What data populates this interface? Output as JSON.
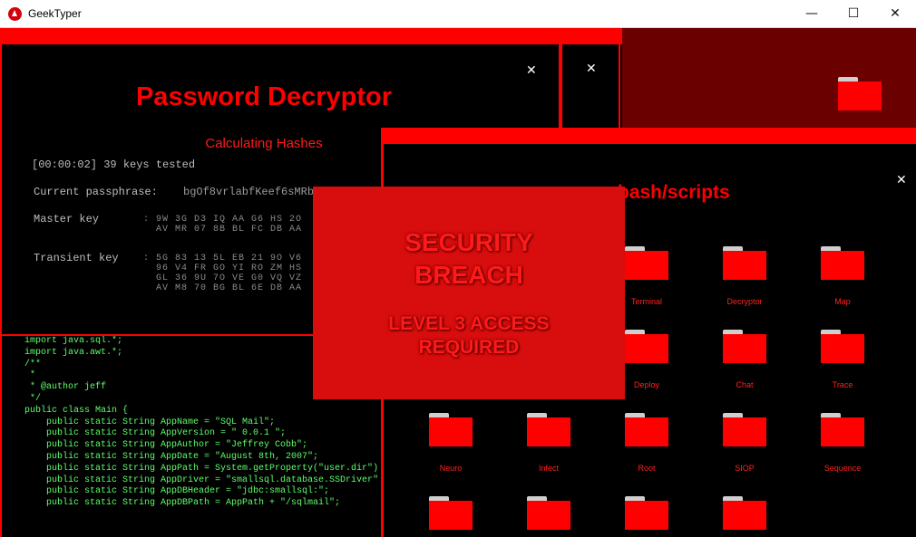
{
  "window": {
    "title": "GeekTyper",
    "minimize": "—",
    "maximize": "☐",
    "close": "✕"
  },
  "password_window": {
    "title": "Password Decryptor",
    "subtitle": "Calculating Hashes",
    "status": "[00:00:02] 39 keys tested",
    "passphrase_label": "Current passphrase:",
    "passphrase_value": "bgOf8vrlabfKeef6sMRb",
    "master_label": "Master key",
    "master_row1": ": 9W 3G D3 IQ AA G6 HS 2O",
    "master_row2": "  AV MR 07 8B BL FC DB AA",
    "transient_label": "Transient key",
    "transient_row1": ": 5G 83 13 5L EB 21 9O V6",
    "transient_row2": "  96 V4 FR GO YI RO ZM HS",
    "transient_row3": "  GL 36 9U 7O VE G0 VQ VZ",
    "transient_row4": "  AV M8 70 BG BL 6E DB AA",
    "close": "✕"
  },
  "small_window": {
    "close": "✕"
  },
  "code_window": {
    "lines": [
      "import java.sql.*;",
      "import java.awt.*;",
      "",
      "/**",
      " *",
      " * @author jeff",
      " */",
      "public class Main {",
      "",
      "    public static String AppName = \"SQL Mail\";",
      "    public static String AppVersion = \" 0.0.1 \";",
      "    public static String AppAuthor = \"Jeffrey Cobb\";",
      "    public static String AppDate = \"August 8th, 2007\";",
      "    public static String AppPath = System.getProperty(\"user.dir\")",
      "    public static String AppDriver = \"smallsql.database.SSDriver\"",
      "    public static String AppDBHeader = \"jdbc:smallsql:\";",
      "    public static String AppDBPath = AppPath + \"/sqlmail\";"
    ]
  },
  "scripts_window": {
    "title": "bash/scripts",
    "close": "✕",
    "folders": [
      "Terminal",
      "Decryptor",
      "Map",
      "Deploy",
      "Chat",
      "Trace",
      "Neuro",
      "Infect",
      "Root",
      "SIOP",
      "Sequence"
    ]
  },
  "breach": {
    "line1": "SECURITY",
    "line2": "BREACH",
    "line3": "LEVEL 3 ACCESS",
    "line4": "REQUIRED"
  },
  "colors": {
    "accent": "#ff0000",
    "dark_red": "#6a0000",
    "breach_bg": "#d80d0d",
    "code_green": "#5dff6a"
  }
}
